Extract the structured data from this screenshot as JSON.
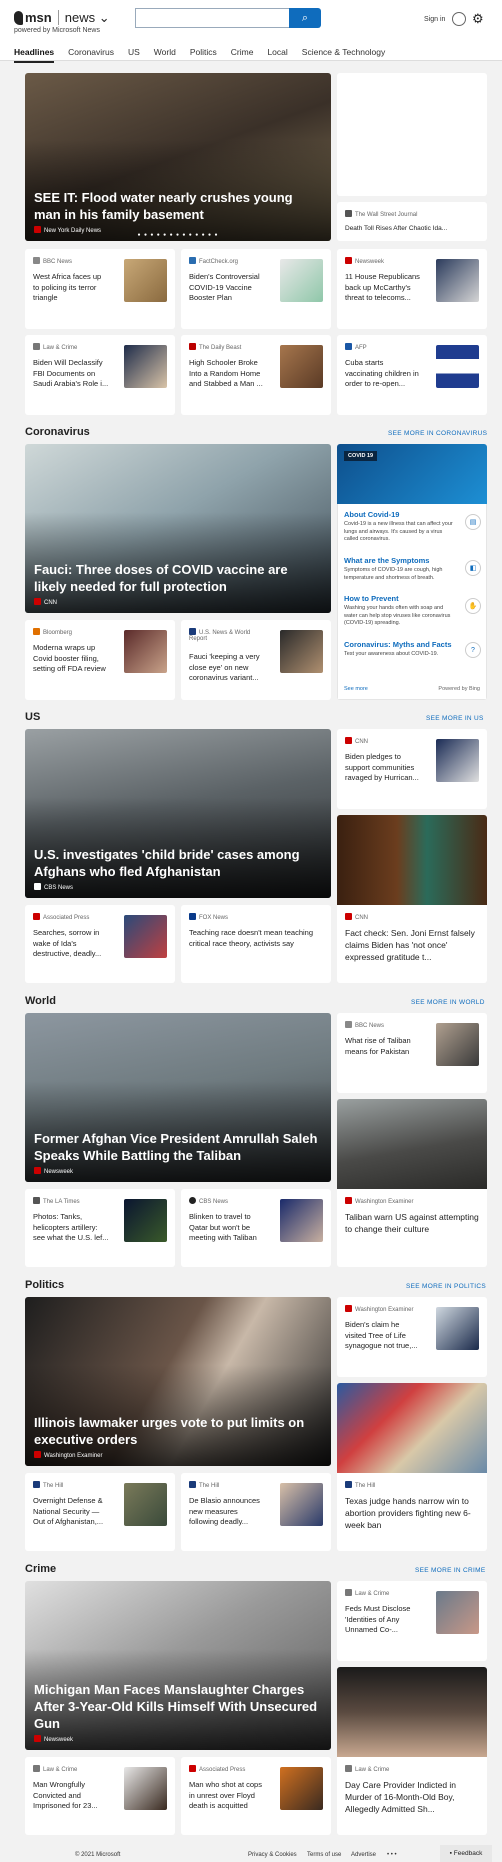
{
  "header": {
    "brand": "msn",
    "section": "news",
    "powered": "powered by Microsoft News",
    "search_value": "",
    "signin": "Sign in"
  },
  "nav": [
    "Headlines",
    "Coronavirus",
    "US",
    "World",
    "Politics",
    "Crime",
    "Local",
    "Science & Technology"
  ],
  "headlines": {
    "hero": {
      "title": "SEE IT: Flood water nearly crushes young man in his family basement",
      "source": "New York Daily News",
      "dots": "● ● ● ● ● ● ● ● ● ● ● ● ●"
    },
    "side": {
      "source": "The Wall Street Journal",
      "title": "Death Toll Rises After Chaotic Ida..."
    },
    "cards": [
      {
        "source": "BBC News",
        "title": "West Africa faces up to policing its terror triangle"
      },
      {
        "source": "FactCheck.org",
        "title": "Biden's Controversial COVID-19 Vaccine Booster Plan"
      },
      {
        "source": "Newsweek",
        "title": "11 House Republicans back up McCarthy's threat to telecoms..."
      },
      {
        "source": "Law & Crime",
        "title": "Biden Will Declassify FBI Documents on Saudi Arabia's Role i..."
      },
      {
        "source": "The Daily Beast",
        "title": "High Schooler Broke Into a Random Home and Stabbed a Man ..."
      },
      {
        "source": "AFP",
        "title": "Cuba starts vaccinating children in order to re-open..."
      }
    ]
  },
  "coronavirus": {
    "heading": "Coronavirus",
    "more": "SEE MORE IN CORONAVIRUS",
    "hero": {
      "title": "Fauci: Three doses of COVID vaccine are likely needed for full protection",
      "source": "CNN"
    },
    "cards": [
      {
        "source": "Bloomberg",
        "title": "Moderna wraps up Covid booster filing, setting off FDA review"
      },
      {
        "source": "U.S. News & World Report",
        "title": "Fauci 'keeping a very close eye' on new coronavirus variant..."
      }
    ],
    "panel": {
      "badge": "COVID 19",
      "items": [
        {
          "title": "About Covid-19",
          "text": "Covid-19 is a new illness that can affect your lungs and airways. It's caused by a virus called coronavirus."
        },
        {
          "title": "What are the Symptoms",
          "text": "Symptoms of COVID-19 are cough, high temperature and shortness of breath."
        },
        {
          "title": "How to Prevent",
          "text": "Washing your hands often with soap and water can help stop viruses like coronavirus (COVID-19) spreading."
        },
        {
          "title": "Coronavirus: Myths and Facts",
          "text": "Test your awareness about COVID-19."
        }
      ],
      "see_more": "See more",
      "powered": "Powered by Bing"
    }
  },
  "us": {
    "heading": "US",
    "more": "SEE MORE IN US",
    "hero": {
      "title": "U.S. investigates 'child bride' cases among Afghans who fled Afghanistan",
      "source": "CBS News"
    },
    "side": {
      "source": "CNN",
      "title": "Biden pledges to support communities ravaged by Hurrican..."
    },
    "tall": {
      "source": "CNN",
      "title": "Fact check: Sen. Joni Ernst falsely claims Biden has 'not once' expressed gratitude t..."
    },
    "cards": [
      {
        "source": "Associated Press",
        "title": "Searches, sorrow in wake of Ida's destructive, deadly..."
      },
      {
        "source": "FOX News",
        "title": "Teaching race doesn't mean teaching critical race theory, activists say"
      }
    ]
  },
  "world": {
    "heading": "World",
    "more": "SEE MORE IN WORLD",
    "hero": {
      "title": "Former Afghan Vice President Amrullah Saleh Speaks While Battling the Taliban",
      "source": "Newsweek"
    },
    "side": {
      "source": "BBC News",
      "title": "What rise of Taliban means for Pakistan"
    },
    "tall": {
      "source": "Washington Examiner",
      "title": "Taliban warn US against attempting to change their culture"
    },
    "cards": [
      {
        "source": "The LA Times",
        "title": "Photos: Tanks, helicopters artillery: see what the U.S. lef..."
      },
      {
        "source": "CBS News",
        "title": "Blinken to travel to Qatar but won't be meeting with Taliban"
      }
    ]
  },
  "politics": {
    "heading": "Politics",
    "more": "SEE MORE IN POLITICS",
    "hero": {
      "title": "Illinois lawmaker urges vote to put limits on executive orders",
      "source": "Washington Examiner"
    },
    "side": {
      "source": "Washington Examiner",
      "title": "Biden's claim he visited Tree of Life synagogue not true,..."
    },
    "tall": {
      "source": "The Hill",
      "title": "Texas judge hands narrow win to abortion providers fighting new 6-week ban"
    },
    "cards": [
      {
        "source": "The Hill",
        "title": "Overnight Defense & National Security — Out of Afghanistan,..."
      },
      {
        "source": "The Hill",
        "title": "De Blasio announces new measures following deadly..."
      }
    ]
  },
  "crime": {
    "heading": "Crime",
    "more": "SEE MORE IN CRIME",
    "hero": {
      "title": "Michigan Man Faces Manslaughter Charges After 3-Year-Old Kills Himself With Unsecured Gun",
      "source": "Newsweek"
    },
    "side": {
      "source": "Law & Crime",
      "title": "Feds Must Disclose 'Identities of Any Unnamed Co-..."
    },
    "tall": {
      "source": "Law & Crime",
      "title": "Day Care Provider Indicted in Murder of 16-Month-Old Boy, Allegedly Admitted Sh..."
    },
    "cards": [
      {
        "source": "Law & Crime",
        "title": "Man Wrongfully Convicted and Imprisoned for 23..."
      },
      {
        "source": "Associated Press",
        "title": "Man who shot at cops in unrest over Floyd death is acquitted"
      }
    ]
  },
  "footer": {
    "copyright": "© 2021 Microsoft",
    "privacy": "Privacy & Cookies",
    "terms": "Terms of use",
    "advertise": "Advertise",
    "more": "• • •",
    "feedback": "Feedback"
  }
}
